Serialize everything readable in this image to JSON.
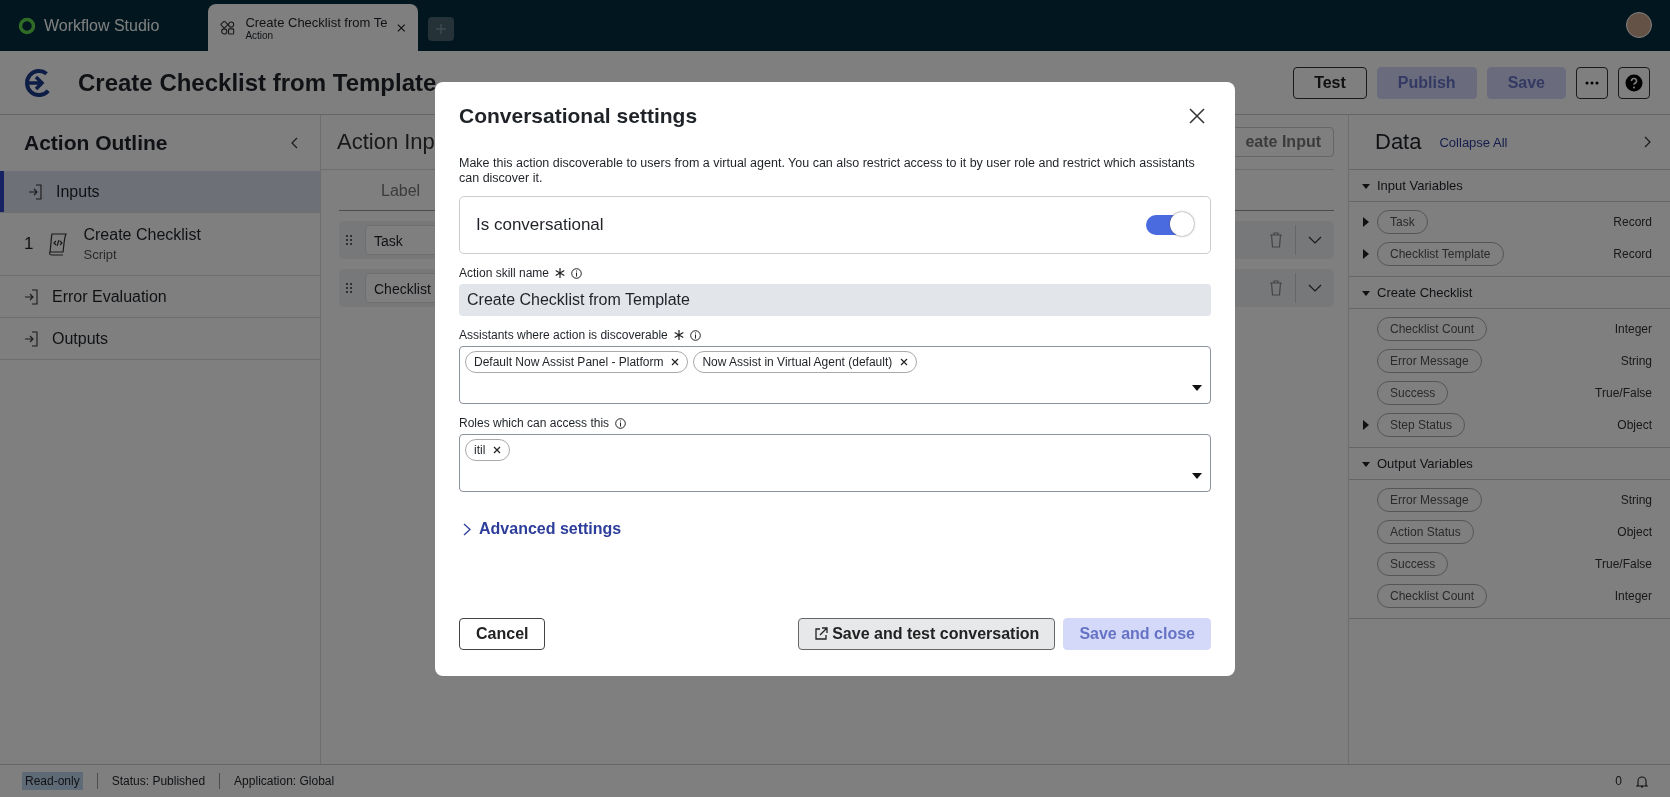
{
  "top_bar": {
    "app_name": "Workflow Studio",
    "tabs": [
      {
        "title": "Create Checklist from Te",
        "subtitle": "Action"
      }
    ]
  },
  "header": {
    "title": "Create Checklist from Template",
    "buttons": [
      {
        "label": "Test",
        "disabled": false
      },
      {
        "label": "Publish",
        "disabled": true
      },
      {
        "label": "Save",
        "disabled": true
      }
    ]
  },
  "sidebar": {
    "title": "Action Outline",
    "items": [
      {
        "kind": "section",
        "label": "Inputs",
        "selected": true
      },
      {
        "kind": "step",
        "number": "1",
        "label": "Create Checklist",
        "sublabel": "Script",
        "selected": false
      },
      {
        "kind": "section",
        "label": "Error Evaluation",
        "selected": false
      },
      {
        "kind": "section",
        "label": "Outputs",
        "selected": false
      }
    ]
  },
  "main": {
    "title": "Action Inp",
    "create_button": "eate Input",
    "columns": [
      "Label"
    ],
    "rows": [
      {
        "label": "Task"
      },
      {
        "label": "Checklist"
      }
    ]
  },
  "data_panel": {
    "title": "Data",
    "collapse_link": "Collapse All",
    "sections": [
      {
        "title": "Input Variables",
        "expanded": true,
        "variables": [
          {
            "name": "Task",
            "type": "Record",
            "expandable": true
          },
          {
            "name": "Checklist Template",
            "type": "Record",
            "expandable": true
          }
        ]
      },
      {
        "title": "Create Checklist",
        "expanded": true,
        "variables": [
          {
            "name": "Checklist Count",
            "type": "Integer",
            "expandable": false
          },
          {
            "name": "Error Message",
            "type": "String",
            "expandable": false
          },
          {
            "name": "Success",
            "type": "True/False",
            "expandable": false
          },
          {
            "name": "Step Status",
            "type": "Object",
            "expandable": true
          }
        ]
      },
      {
        "title": "Output Variables",
        "expanded": true,
        "variables": [
          {
            "name": "Error Message",
            "type": "String",
            "expandable": false
          },
          {
            "name": "Action Status",
            "type": "Object",
            "expandable": false
          },
          {
            "name": "Success",
            "type": "True/False",
            "expandable": false
          },
          {
            "name": "Checklist Count",
            "type": "Integer",
            "expandable": false
          }
        ]
      }
    ]
  },
  "status_bar": {
    "badge": "Read-only",
    "items": [
      "Status: Published",
      "Application: Global"
    ],
    "notifications": "0"
  },
  "dialog": {
    "title": "Conversational settings",
    "description": "Make this action discoverable to users from a virtual agent. You can also restrict access to it by user role and restrict which assistants can discover it.",
    "toggle": {
      "label": "Is conversational",
      "on": true
    },
    "skill_name": {
      "label": "Action skill name",
      "required": true,
      "value": "Create Checklist from Template"
    },
    "assistants": {
      "label": "Assistants where action is discoverable",
      "required": true,
      "chips": [
        "Default Now Assist Panel - Platform",
        "Now Assist in Virtual Agent (default)"
      ]
    },
    "roles": {
      "label": "Roles which can access this",
      "required": false,
      "chips": [
        "itil"
      ]
    },
    "advanced": {
      "label": "Advanced settings",
      "expanded": false
    },
    "buttons": [
      {
        "kind": "secondary",
        "label": "Cancel",
        "disabled": false
      },
      {
        "kind": "tertiary",
        "label": "Save and test conversation",
        "disabled": false
      },
      {
        "kind": "primary",
        "label": "Save and close",
        "disabled": true
      }
    ]
  }
}
